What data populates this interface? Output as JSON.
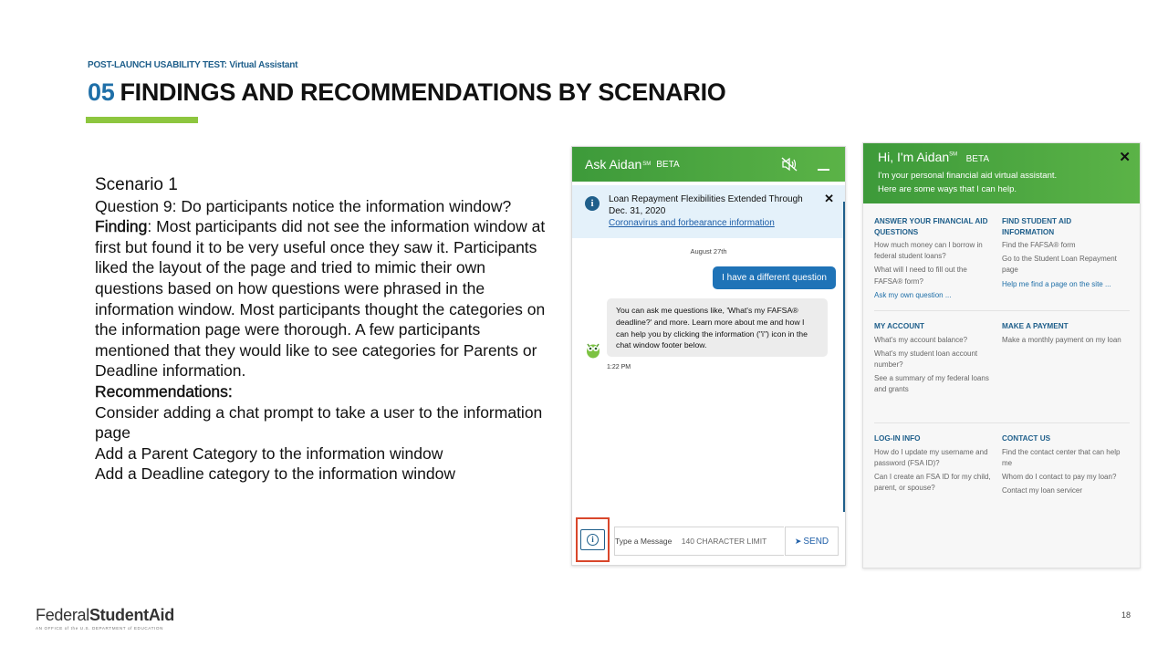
{
  "slide": {
    "overline": "POST-LAUNCH USABILITY TEST: Virtual Assistant",
    "title_number": "05",
    "title_text": "FINDINGS AND RECOMMENDATIONS BY SCENARIO",
    "scenario": "Scenario 1",
    "question": "Question 9: Do participants notice the information window?",
    "finding_label": "Finding",
    "finding_text": ": Most participants did not see the information window at first but found it to be very useful once they saw it. Participants liked the layout of the page and tried to mimic their own questions based on how questions were phrased in the information window. Most participants thought the categories on the information page were thorough. A few participants mentioned that they would like to see categories for Parents or Deadline information.",
    "recommendations_label": "Recommendations:",
    "recommendations": [
      "Consider adding a chat prompt to take a user to the information page",
      "Add a Parent Category to the information window",
      "Add a Deadline category to the information window"
    ],
    "page_number": "18",
    "accent_color": "#8dc63f",
    "title_accent_color": "#1f6fa8"
  },
  "chat_window": {
    "title": "Ask Aidan",
    "sm": "SM",
    "beta": "BETA",
    "mute_icon": "mute-speaker-icon",
    "notice_text": "Loan Repayment Flexibilities Extended Through Dec. 31, 2020",
    "notice_link": "Coronavirus and forbearance information",
    "notice_close": "✕",
    "date": "August 27th",
    "user_message": "I have a different question",
    "bot_message": "You can ask me questions like, 'What's my FAFSA® deadline?' and more. Learn more about me and how I can help you by clicking the information (\"i\") icon in the chat window footer below.",
    "time": "1:22 PM",
    "input_placeholder": "Type a Message",
    "char_limit": "140 CHARACTER LIMIT",
    "send_label": "SEND",
    "header_color": "#4aa63f"
  },
  "info_window": {
    "greeting": "Hi, I'm Aidan",
    "sm": "SM",
    "beta": "BETA",
    "subtitle_1": "I'm your personal financial aid virtual assistant.",
    "subtitle_2": "Here are some ways that I can help.",
    "close": "✕",
    "sections": [
      {
        "left": {
          "category": "ANSWER YOUR FINANCIAL AID QUESTIONS",
          "items": [
            "How much money can I borrow in federal student loans?",
            "What will I need to fill out the FAFSA® form?"
          ],
          "link": "Ask my own question ..."
        },
        "right": {
          "category": "FIND STUDENT AID INFORMATION",
          "items": [
            "Find the FAFSA® form",
            "Go to the Student Loan Repayment page"
          ],
          "link": "Help me find a page on the site ..."
        }
      },
      {
        "left": {
          "category": "MY ACCOUNT",
          "items": [
            "What's my account balance?",
            "What's my student loan account number?",
            "See a summary of my federal loans and grants"
          ]
        },
        "right": {
          "category": "MAKE A PAYMENT",
          "items": [
            "Make a monthly payment on my loan"
          ]
        }
      },
      {
        "left": {
          "category": "LOG-IN INFO",
          "items": [
            "How do I update my username and password (FSA ID)?",
            "Can I create an FSA ID for my child, parent, or spouse?"
          ]
        },
        "right": {
          "category": "CONTACT US",
          "items": [
            "Find the contact center that can help me",
            "Whom do I contact to pay my loan?",
            "Contact my loan servicer"
          ]
        }
      }
    ]
  },
  "logo": {
    "federal": "Federal",
    "student_aid": "StudentAid",
    "tagline": "AN OFFICE of the U.S. DEPARTMENT of EDUCATION"
  }
}
